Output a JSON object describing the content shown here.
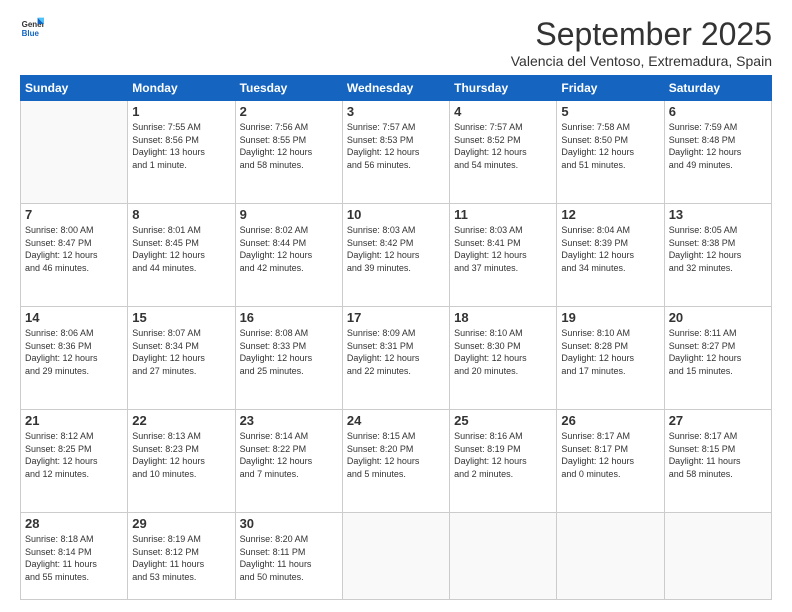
{
  "header": {
    "logo_general": "General",
    "logo_blue": "Blue",
    "month_title": "September 2025",
    "location": "Valencia del Ventoso, Extremadura, Spain"
  },
  "days_of_week": [
    "Sunday",
    "Monday",
    "Tuesday",
    "Wednesday",
    "Thursday",
    "Friday",
    "Saturday"
  ],
  "weeks": [
    [
      {
        "day": "",
        "info": ""
      },
      {
        "day": "1",
        "info": "Sunrise: 7:55 AM\nSunset: 8:56 PM\nDaylight: 13 hours\nand 1 minute."
      },
      {
        "day": "2",
        "info": "Sunrise: 7:56 AM\nSunset: 8:55 PM\nDaylight: 12 hours\nand 58 minutes."
      },
      {
        "day": "3",
        "info": "Sunrise: 7:57 AM\nSunset: 8:53 PM\nDaylight: 12 hours\nand 56 minutes."
      },
      {
        "day": "4",
        "info": "Sunrise: 7:57 AM\nSunset: 8:52 PM\nDaylight: 12 hours\nand 54 minutes."
      },
      {
        "day": "5",
        "info": "Sunrise: 7:58 AM\nSunset: 8:50 PM\nDaylight: 12 hours\nand 51 minutes."
      },
      {
        "day": "6",
        "info": "Sunrise: 7:59 AM\nSunset: 8:48 PM\nDaylight: 12 hours\nand 49 minutes."
      }
    ],
    [
      {
        "day": "7",
        "info": "Sunrise: 8:00 AM\nSunset: 8:47 PM\nDaylight: 12 hours\nand 46 minutes."
      },
      {
        "day": "8",
        "info": "Sunrise: 8:01 AM\nSunset: 8:45 PM\nDaylight: 12 hours\nand 44 minutes."
      },
      {
        "day": "9",
        "info": "Sunrise: 8:02 AM\nSunset: 8:44 PM\nDaylight: 12 hours\nand 42 minutes."
      },
      {
        "day": "10",
        "info": "Sunrise: 8:03 AM\nSunset: 8:42 PM\nDaylight: 12 hours\nand 39 minutes."
      },
      {
        "day": "11",
        "info": "Sunrise: 8:03 AM\nSunset: 8:41 PM\nDaylight: 12 hours\nand 37 minutes."
      },
      {
        "day": "12",
        "info": "Sunrise: 8:04 AM\nSunset: 8:39 PM\nDaylight: 12 hours\nand 34 minutes."
      },
      {
        "day": "13",
        "info": "Sunrise: 8:05 AM\nSunset: 8:38 PM\nDaylight: 12 hours\nand 32 minutes."
      }
    ],
    [
      {
        "day": "14",
        "info": "Sunrise: 8:06 AM\nSunset: 8:36 PM\nDaylight: 12 hours\nand 29 minutes."
      },
      {
        "day": "15",
        "info": "Sunrise: 8:07 AM\nSunset: 8:34 PM\nDaylight: 12 hours\nand 27 minutes."
      },
      {
        "day": "16",
        "info": "Sunrise: 8:08 AM\nSunset: 8:33 PM\nDaylight: 12 hours\nand 25 minutes."
      },
      {
        "day": "17",
        "info": "Sunrise: 8:09 AM\nSunset: 8:31 PM\nDaylight: 12 hours\nand 22 minutes."
      },
      {
        "day": "18",
        "info": "Sunrise: 8:10 AM\nSunset: 8:30 PM\nDaylight: 12 hours\nand 20 minutes."
      },
      {
        "day": "19",
        "info": "Sunrise: 8:10 AM\nSunset: 8:28 PM\nDaylight: 12 hours\nand 17 minutes."
      },
      {
        "day": "20",
        "info": "Sunrise: 8:11 AM\nSunset: 8:27 PM\nDaylight: 12 hours\nand 15 minutes."
      }
    ],
    [
      {
        "day": "21",
        "info": "Sunrise: 8:12 AM\nSunset: 8:25 PM\nDaylight: 12 hours\nand 12 minutes."
      },
      {
        "day": "22",
        "info": "Sunrise: 8:13 AM\nSunset: 8:23 PM\nDaylight: 12 hours\nand 10 minutes."
      },
      {
        "day": "23",
        "info": "Sunrise: 8:14 AM\nSunset: 8:22 PM\nDaylight: 12 hours\nand 7 minutes."
      },
      {
        "day": "24",
        "info": "Sunrise: 8:15 AM\nSunset: 8:20 PM\nDaylight: 12 hours\nand 5 minutes."
      },
      {
        "day": "25",
        "info": "Sunrise: 8:16 AM\nSunset: 8:19 PM\nDaylight: 12 hours\nand 2 minutes."
      },
      {
        "day": "26",
        "info": "Sunrise: 8:17 AM\nSunset: 8:17 PM\nDaylight: 12 hours\nand 0 minutes."
      },
      {
        "day": "27",
        "info": "Sunrise: 8:17 AM\nSunset: 8:15 PM\nDaylight: 11 hours\nand 58 minutes."
      }
    ],
    [
      {
        "day": "28",
        "info": "Sunrise: 8:18 AM\nSunset: 8:14 PM\nDaylight: 11 hours\nand 55 minutes."
      },
      {
        "day": "29",
        "info": "Sunrise: 8:19 AM\nSunset: 8:12 PM\nDaylight: 11 hours\nand 53 minutes."
      },
      {
        "day": "30",
        "info": "Sunrise: 8:20 AM\nSunset: 8:11 PM\nDaylight: 11 hours\nand 50 minutes."
      },
      {
        "day": "",
        "info": ""
      },
      {
        "day": "",
        "info": ""
      },
      {
        "day": "",
        "info": ""
      },
      {
        "day": "",
        "info": ""
      }
    ]
  ]
}
